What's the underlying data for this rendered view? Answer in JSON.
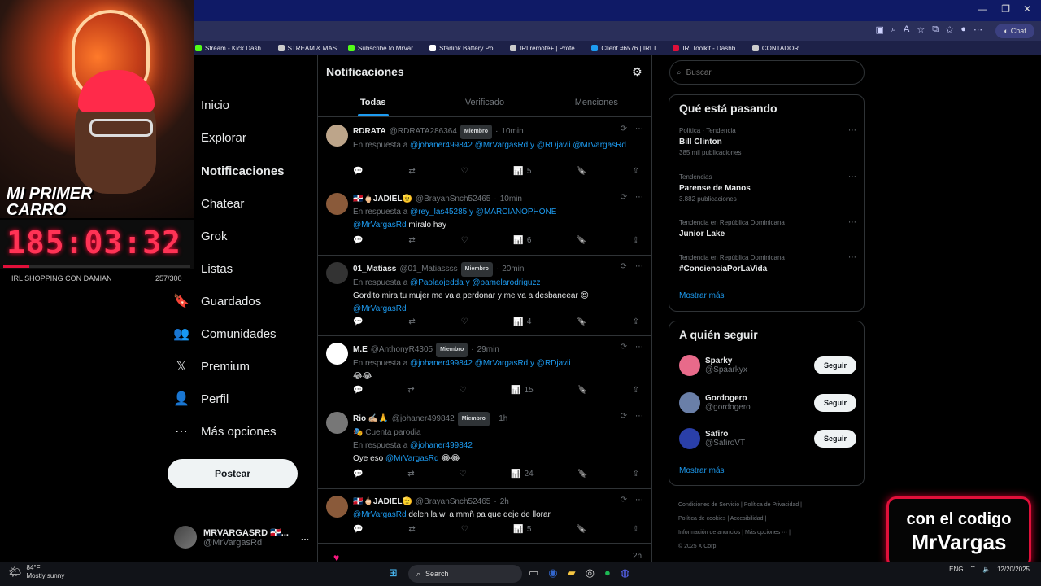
{
  "browser": {
    "bookmarks": [
      {
        "label": "Stream - Kick Dash...",
        "color": "#53fc18"
      },
      {
        "label": "STREAM & MAS",
        "color": "#cccccc"
      },
      {
        "label": "Subscribe to MrVar...",
        "color": "#53fc18"
      },
      {
        "label": "Starlink Battery Po...",
        "color": "#ffffff"
      },
      {
        "label": "IRLremote+ | Profe...",
        "color": "#cccccc"
      },
      {
        "label": "Client #6576 | IRLT...",
        "color": "#1d9bf0"
      },
      {
        "label": "IRLToolkit - Dashb...",
        "color": "#e0103a"
      },
      {
        "label": "CONTADOR",
        "color": "#cccccc"
      }
    ],
    "chat_label": "Chat",
    "window_controls": [
      "—",
      "❐",
      "✕"
    ]
  },
  "stream": {
    "title_line1": "MI PRIMER",
    "title_line2": "CARRO",
    "timer": "185:03:32",
    "shop_label": "IRL SHOPPING CON DAMIAN",
    "shop_count": "257/300",
    "shop_progress": 0.14,
    "promo_line1": "con el codigo",
    "promo_line2": "MrVargas"
  },
  "sidebar": {
    "items": [
      {
        "label": "Inicio",
        "icon": "home-icon",
        "glyph": ""
      },
      {
        "label": "Explorar",
        "icon": "search-icon",
        "glyph": ""
      },
      {
        "label": "Notificaciones",
        "icon": "bell-icon",
        "glyph": "",
        "active": true
      },
      {
        "label": "Chatear",
        "icon": "chat-icon",
        "glyph": ""
      },
      {
        "label": "Grok",
        "icon": "grok-icon",
        "glyph": ""
      },
      {
        "label": "Listas",
        "icon": "list-icon",
        "glyph": ""
      },
      {
        "label": "Guardados",
        "icon": "bookmark-icon",
        "glyph": "🔖"
      },
      {
        "label": "Comunidades",
        "icon": "communities-icon",
        "glyph": "👥"
      },
      {
        "label": "Premium",
        "icon": "x-logo-icon",
        "glyph": "𝕏"
      },
      {
        "label": "Perfil",
        "icon": "profile-icon",
        "glyph": "👤"
      },
      {
        "label": "Más opciones",
        "icon": "more-options-icon",
        "glyph": "⋯"
      }
    ],
    "post_button": "Postear",
    "account": {
      "name": "MRVARGASRD 🇩🇴...",
      "handle": "@MrVargasRd",
      "menu": "..."
    }
  },
  "main": {
    "title": "Notificaciones",
    "tabs": [
      {
        "label": "Todas",
        "active": true
      },
      {
        "label": "Verificado"
      },
      {
        "label": "Menciones"
      }
    ],
    "tweets": [
      {
        "name": "RDRATA",
        "handle": "@RDRATA286364",
        "badge": "Miembro",
        "time": "10min",
        "sub": "",
        "reply_prefix": "En respuesta a",
        "reply_to": "@johaner499842 @MrVargasRd y @RDjavii @MrVargasRd",
        "text": "",
        "views": "5",
        "avatar_color": "#bda58a"
      },
      {
        "name": "🇩🇴🖕🏻JADIEL🫡",
        "handle": "@BrayanSnch52465",
        "badge": "",
        "time": "10min",
        "sub": "",
        "reply_prefix": "En respuesta a",
        "reply_to": "@rey_las45285 y @MARCIANOPHONE",
        "mention": "@MrVargasRd",
        "text": "míralo hay",
        "views": "6",
        "avatar_color": "#8a5a3a"
      },
      {
        "name": "01_Matiass",
        "handle": "@01_Matiassss",
        "badge": "Miembro",
        "time": "20min",
        "sub": "",
        "reply_prefix": "En respuesta a",
        "reply_to": "@Paolaojedda y @pamelarodriguzz",
        "text": "Gordito mira tu mujer me va a perdonar y me va a desbaneear 😍",
        "mention_after": "@MrVargasRd",
        "views": "4",
        "avatar_color": "#333333"
      },
      {
        "name": "M.E",
        "handle": "@AnthonyR4305",
        "badge": "Miembro",
        "time": "29min",
        "sub": "",
        "reply_prefix": "En respuesta a",
        "reply_to": "@johaner499842 @MrVargasRd y @RDjavii",
        "text": "😂😂",
        "views": "15",
        "avatar_color": "#ffffff"
      },
      {
        "name": "Rio ✍🏼🙏",
        "handle": "@johaner499842",
        "badge": "Miembro",
        "time": "1h",
        "sub": "🎭 Cuenta parodia",
        "reply_prefix": "En respuesta a",
        "reply_to": "@johaner499842",
        "text_prefix": "Oye eso",
        "mention": "@MrVargasRd",
        "text": "😂😂",
        "views": "24",
        "avatar_color": "#777777"
      },
      {
        "name": "🇩🇴🖕🏻JADIEL🫡",
        "handle": "@BrayanSnch52465",
        "badge": "",
        "time": "2h",
        "sub": "",
        "reply_prefix": "",
        "reply_to": "",
        "mention": "@MrVargasRd",
        "text": "delen la wl a mmñ pa que deje de llorar",
        "views": "5",
        "avatar_color": "#8a5a3a"
      }
    ],
    "last_time": "2h"
  },
  "right": {
    "search_placeholder": "Buscar",
    "trending_title": "Qué está pasando",
    "trends": [
      {
        "meta": "Política · Tendencia",
        "name": "Bill Clinton",
        "count": "385 mil publicaciones"
      },
      {
        "meta": "Tendencias",
        "name": "Parense de Manos",
        "count": "3.882 publicaciones"
      },
      {
        "meta": "Tendencia en República Dominicana",
        "name": "Junior Lake",
        "count": ""
      },
      {
        "meta": "Tendencia en República Dominicana",
        "name": "#ConcienciaPorLaVida",
        "count": ""
      }
    ],
    "show_more": "Mostrar más",
    "follow_title": "A quién seguir",
    "follow": [
      {
        "name": "Sparky",
        "handle": "@Spaarkyx",
        "button": "Seguir",
        "color": "#e86a8a"
      },
      {
        "name": "Gordogero",
        "handle": "@gordogero",
        "button": "Seguir",
        "color": "#6a7fa8"
      },
      {
        "name": "Safiro",
        "handle": "@SafiroVT",
        "button": "Seguir",
        "color": "#2a3fa8"
      }
    ],
    "show_more_follow": "Mostrar más",
    "footer": [
      "Condiciones de Servicio",
      "Política de Privacidad",
      "Política de cookies",
      "Accesibilidad",
      "Información de anuncios",
      "Más opciones ···",
      "© 2025 X Corp."
    ]
  },
  "taskbar": {
    "temp": "84°F",
    "weather": "Mostly sunny",
    "search": "Search",
    "lang": "ENG",
    "date": "12/20/2025"
  }
}
